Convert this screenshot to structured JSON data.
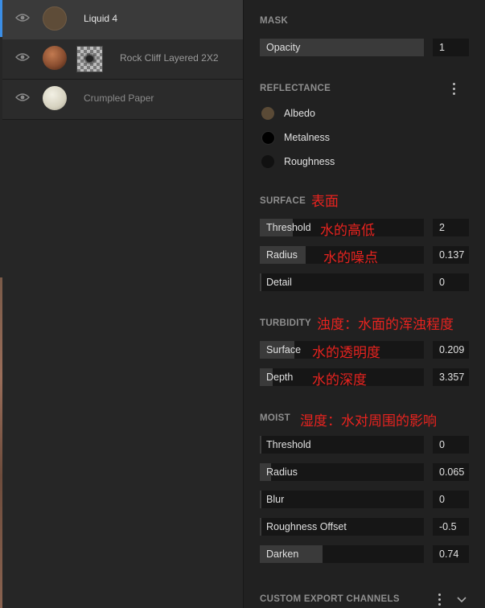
{
  "layers": [
    {
      "name": "Liquid 4",
      "selected": true,
      "thumb_color": "#5e4c38"
    },
    {
      "name": "Rock Cliff Layered 2X2",
      "selected": false,
      "thumb_color": "#8a4e30"
    },
    {
      "name": "Crumpled Paper",
      "selected": false,
      "thumb_color": "#dedbcc"
    }
  ],
  "mask": {
    "title": "MASK",
    "opacity_label": "Opacity",
    "opacity_value": "1",
    "opacity_fill": 1.0
  },
  "reflectance": {
    "title": "REFLECTANCE",
    "items": [
      {
        "label": "Albedo",
        "color": "#5a4a36"
      },
      {
        "label": "Metalness",
        "color": "#000000"
      },
      {
        "label": "Roughness",
        "color": "#111111"
      }
    ]
  },
  "surface": {
    "title": "SURFACE",
    "annotation": "表面",
    "params": [
      {
        "label": "Threshold",
        "value": "2",
        "fill": 0.2,
        "annotation": "水的高低"
      },
      {
        "label": "Radius",
        "value": "0.137",
        "fill": 0.28,
        "annotation": "水的噪点"
      },
      {
        "label": "Detail",
        "value": "0",
        "fill": 0.0,
        "annotation": ""
      }
    ]
  },
  "turbidity": {
    "title": "TURBIDITY",
    "annotation": "浊度：水面的浑浊程度",
    "params": [
      {
        "label": "Surface",
        "value": "0.209",
        "fill": 0.21,
        "annotation": "水的透明度"
      },
      {
        "label": "Depth",
        "value": "3.357",
        "fill": 0.08,
        "annotation": "水的深度"
      }
    ]
  },
  "moist": {
    "title": "MOIST",
    "annotation": "湿度：水对周围的影响",
    "params": [
      {
        "label": "Threshold",
        "value": "0",
        "fill": 0.0
      },
      {
        "label": "Radius",
        "value": "0.065",
        "fill": 0.065
      },
      {
        "label": "Blur",
        "value": "0",
        "fill": 0.0
      },
      {
        "label": "Roughness Offset",
        "value": "-0.5",
        "fill": 0.0
      },
      {
        "label": "Darken",
        "value": "0.74",
        "fill": 0.38
      }
    ]
  },
  "custom_export": {
    "title": "CUSTOM EXPORT CHANNELS"
  }
}
